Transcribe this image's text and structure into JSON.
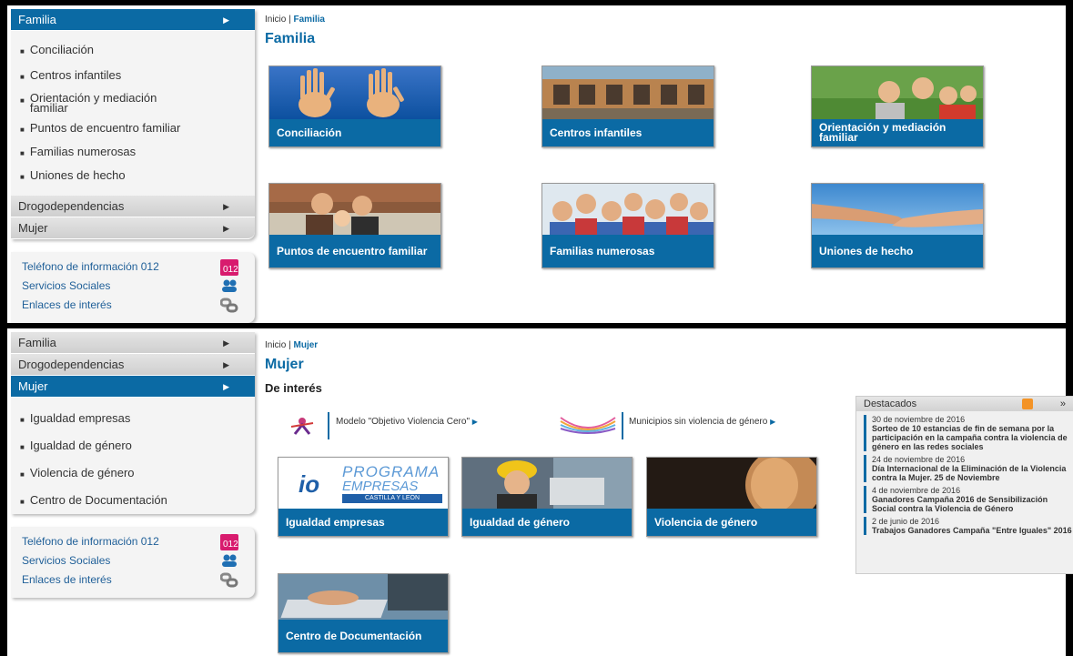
{
  "top": {
    "sidebar": {
      "active_section": "Familia",
      "sub_items": [
        "Conciliación",
        "Centros infantiles",
        "Orientación y mediación familiar",
        "Puntos de encuentro familiar",
        "Familias numerosas",
        "Uniones de hecho"
      ],
      "other_sections": [
        "Drogodependencias",
        "Mujer"
      ]
    },
    "links": [
      {
        "label": "Teléfono de información 012",
        "icon": "phone-012-icon"
      },
      {
        "label": "Servicios Sociales",
        "icon": "people-icon"
      },
      {
        "label": "Enlaces de interés",
        "icon": "chain-link-icon"
      }
    ],
    "breadcrumb": {
      "home": "Inicio",
      "current": "Familia"
    },
    "page_title": "Familia",
    "tiles": [
      "Conciliación",
      "Centros infantiles",
      "Orientación y mediación familiar",
      "Puntos de encuentro familiar",
      "Familias numerosas",
      "Uniones de hecho"
    ]
  },
  "bottom": {
    "sidebar": {
      "sections_before": [
        "Familia",
        "Drogodependencias"
      ],
      "active_section": "Mujer",
      "sub_items": [
        "Igualdad empresas",
        "Igualdad de género",
        "Violencia de género",
        "Centro de Documentación"
      ]
    },
    "links": [
      {
        "label": "Teléfono de información 012",
        "icon": "phone-012-icon"
      },
      {
        "label": "Servicios Sociales",
        "icon": "people-icon"
      },
      {
        "label": "Enlaces de interés",
        "icon": "chain-link-icon"
      }
    ],
    "breadcrumb": {
      "home": "Inicio",
      "current": "Mujer"
    },
    "page_title": "Mujer",
    "section_heading": "De interés",
    "promo_links": [
      "Modelo \"Objetivo Violencia Cero\"",
      "Municipios sin violencia de género"
    ],
    "programa_logo": {
      "line1": "PROGRAMA",
      "line2": "EMPRESAS",
      "line3": "CASTILLA Y LEÓN",
      "mark": "io"
    },
    "tiles": [
      "Igualdad empresas",
      "Igualdad de género",
      "Violencia de género",
      "Centro de Documentación"
    ],
    "destacados": {
      "heading": "Destacados",
      "items": [
        {
          "date": "30 de noviembre de 2016",
          "title": "Sorteo de 10 estancias de fin de semana por la participación en la campaña contra la violencia de género en las redes sociales"
        },
        {
          "date": "24 de noviembre de 2016",
          "title": "Día Internacional de la Eliminación de la Violencia contra la Mujer. 25 de Noviembre"
        },
        {
          "date": "4 de noviembre de 2016",
          "title": "Ganadores Campaña 2016 de Sensibilización Social contra la Violencia de Género"
        },
        {
          "date": "2 de junio de 2016",
          "title": "Trabajos Ganadores Campaña \"Entre Iguales\" 2016"
        }
      ]
    }
  },
  "colors": {
    "accent": "#0b6aa4",
    "menu_bg": "#e6e6e6",
    "rss": "#f39326",
    "badge_012": "#d81b6e"
  }
}
